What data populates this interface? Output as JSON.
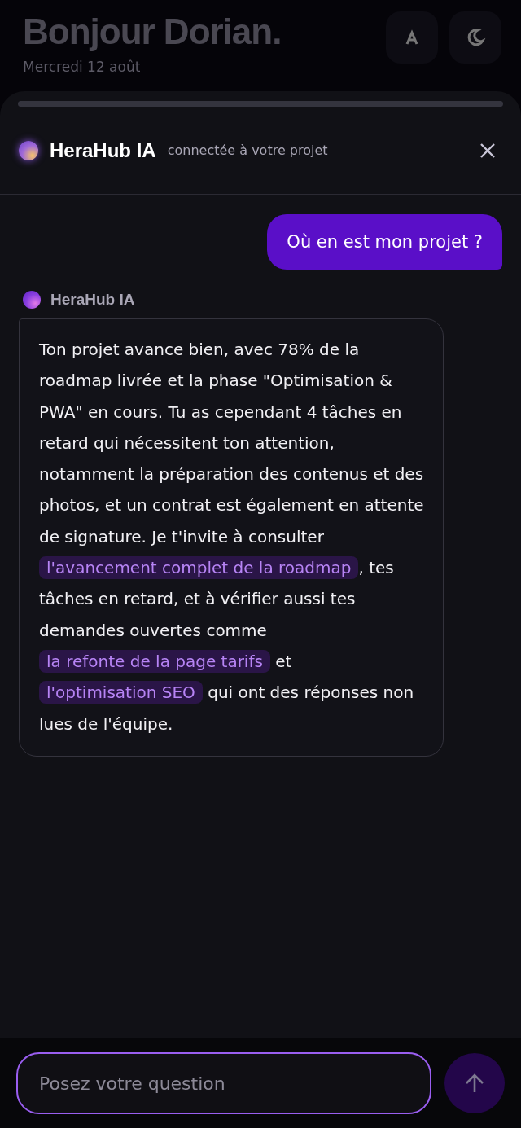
{
  "backdrop": {
    "greeting": "Bonjour Dorian.",
    "date": "Mercredi 12 août"
  },
  "assistant": {
    "name": "HeraHub IA",
    "status": "connectée à votre projet"
  },
  "messages": [
    {
      "kind": "user",
      "text": "Où en est mon projet ?"
    },
    {
      "kind": "assistant",
      "author": "HeraHub IA",
      "parts": [
        {
          "kind": "text",
          "text": "Ton projet avance bien, avec 78% de la roadmap livrée et la phase \"Optimisation & PWA\" en cours. Tu as cependant 4 tâches en retard qui nécessitent ton attention, notamment la préparation des contenus et des photos, et un contrat est également en attente de signature. Je t'invite à consulter "
        },
        {
          "kind": "link",
          "text": "l'avancement complet de la roadmap"
        },
        {
          "kind": "text",
          "text": ", tes tâches en retard, et à vérifier aussi tes demandes ouvertes comme "
        },
        {
          "kind": "link",
          "text": "la refonte de la page tarifs"
        },
        {
          "kind": "text",
          "text": " et "
        },
        {
          "kind": "link",
          "text": "l'optimisation SEO"
        },
        {
          "kind": "text",
          "text": " qui ont des réponses non lues de l'équipe."
        }
      ]
    }
  ],
  "composer": {
    "placeholder": "Posez votre question"
  }
}
